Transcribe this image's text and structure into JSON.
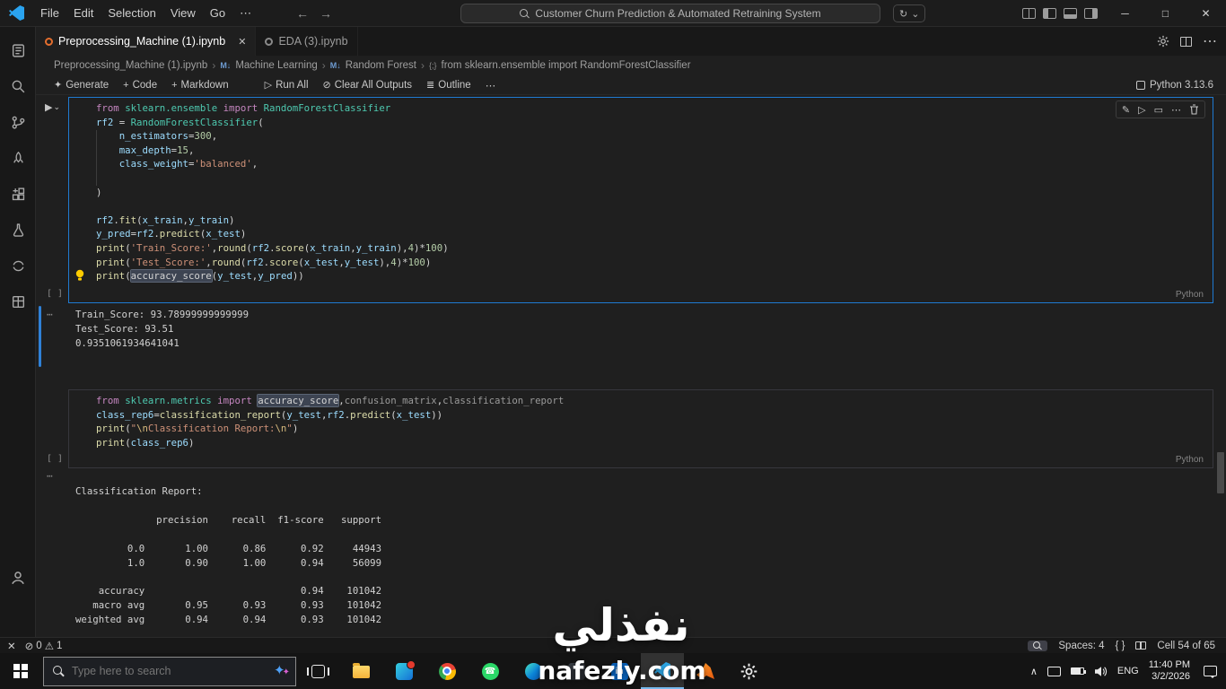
{
  "window": {
    "search_text": "Customer Churn Prediction & Automated Retraining System"
  },
  "menus": [
    "File",
    "Edit",
    "Selection",
    "View",
    "Go"
  ],
  "tabs": [
    {
      "label": "Preprocessing_Machine (1).ipynb"
    },
    {
      "label": "EDA (3).ipynb"
    }
  ],
  "breadcrumbs": [
    "Preprocessing_Machine (1).ipynb",
    "Machine Learning",
    "Random Forest",
    "from sklearn.ensemble import RandomForestClassifier"
  ],
  "toolbar": {
    "generate": "Generate",
    "code": "Code",
    "markdown": "Markdown",
    "run_all": "Run All",
    "clear_outputs": "Clear All Outputs",
    "outline": "Outline",
    "kernel": "Python 3.13.6"
  },
  "cells": [
    {
      "language": "Python",
      "lines": [
        [
          [
            "kw",
            "from"
          ],
          [
            "pun",
            " "
          ],
          [
            "cls",
            "sklearn.ensemble"
          ],
          [
            "pun",
            " "
          ],
          [
            "kw",
            "import"
          ],
          [
            "pun",
            " "
          ],
          [
            "cls",
            "RandomForestClassifier"
          ]
        ],
        [
          [
            "var",
            "rf2"
          ],
          [
            "pun",
            " = "
          ],
          [
            "cls",
            "RandomForestClassifier"
          ],
          [
            "pun",
            "("
          ]
        ],
        [
          [
            "pun",
            "    "
          ],
          [
            "var",
            "n_estimators"
          ],
          [
            "pun",
            "="
          ],
          [
            "num",
            "300"
          ],
          [
            "pun",
            ","
          ]
        ],
        [
          [
            "pun",
            "    "
          ],
          [
            "var",
            "max_depth"
          ],
          [
            "pun",
            "="
          ],
          [
            "num",
            "15"
          ],
          [
            "pun",
            ","
          ]
        ],
        [
          [
            "pun",
            "    "
          ],
          [
            "var",
            "class_weight"
          ],
          [
            "pun",
            "="
          ],
          [
            "str",
            "'balanced'"
          ],
          [
            "pun",
            ","
          ]
        ],
        [],
        [
          [
            "pun",
            ")"
          ]
        ],
        [],
        [
          [
            "var",
            "rf2"
          ],
          [
            "pun",
            "."
          ],
          [
            "fn",
            "fit"
          ],
          [
            "pun",
            "("
          ],
          [
            "var",
            "x_train"
          ],
          [
            "pun",
            ","
          ],
          [
            "var",
            "y_train"
          ],
          [
            "pun",
            ")"
          ]
        ],
        [
          [
            "var",
            "y_pred"
          ],
          [
            "pun",
            "="
          ],
          [
            "var",
            "rf2"
          ],
          [
            "pun",
            "."
          ],
          [
            "fn",
            "predict"
          ],
          [
            "pun",
            "("
          ],
          [
            "var",
            "x_test"
          ],
          [
            "pun",
            ")"
          ]
        ],
        [
          [
            "fn",
            "print"
          ],
          [
            "pun",
            "("
          ],
          [
            "str",
            "'Train_Score:'"
          ],
          [
            "pun",
            ","
          ],
          [
            "fn",
            "round"
          ],
          [
            "pun",
            "("
          ],
          [
            "var",
            "rf2"
          ],
          [
            "pun",
            "."
          ],
          [
            "fn",
            "score"
          ],
          [
            "pun",
            "("
          ],
          [
            "var",
            "x_train"
          ],
          [
            "pun",
            ","
          ],
          [
            "var",
            "y_train"
          ],
          [
            "pun",
            "),"
          ],
          [
            "num",
            "4"
          ],
          [
            "pun",
            ")*"
          ],
          [
            "num",
            "100"
          ],
          [
            "pun",
            ")"
          ]
        ],
        [
          [
            "fn",
            "print"
          ],
          [
            "pun",
            "("
          ],
          [
            "str",
            "'Test_Score:'"
          ],
          [
            "pun",
            ","
          ],
          [
            "fn",
            "round"
          ],
          [
            "pun",
            "("
          ],
          [
            "var",
            "rf2"
          ],
          [
            "pun",
            "."
          ],
          [
            "fn",
            "score"
          ],
          [
            "pun",
            "("
          ],
          [
            "var",
            "x_test"
          ],
          [
            "pun",
            ","
          ],
          [
            "var",
            "y_test"
          ],
          [
            "pun",
            "),"
          ],
          [
            "num",
            "4"
          ],
          [
            "pun",
            ")*"
          ],
          [
            "num",
            "100"
          ],
          [
            "pun",
            ")"
          ]
        ],
        [
          [
            "fn",
            "print"
          ],
          [
            "pun",
            "("
          ],
          [
            "hl",
            "accuracy_score"
          ],
          [
            "pun",
            "("
          ],
          [
            "var",
            "y_test"
          ],
          [
            "pun",
            ","
          ],
          [
            "var",
            "y_pred"
          ],
          [
            "pun",
            "))"
          ]
        ]
      ]
    },
    {
      "language": "Python",
      "lines": [
        [
          [
            "kw",
            "from"
          ],
          [
            "pun",
            " "
          ],
          [
            "cls",
            "sklearn.metrics"
          ],
          [
            "pun",
            " "
          ],
          [
            "kw",
            "import"
          ],
          [
            "pun",
            " "
          ],
          [
            "hl",
            "accuracy_score"
          ],
          [
            "pun",
            ","
          ],
          [
            "dim",
            "confusion_matrix"
          ],
          [
            "pun",
            ","
          ],
          [
            "dim",
            "classification_report"
          ]
        ],
        [
          [
            "var",
            "class_rep6"
          ],
          [
            "pun",
            "="
          ],
          [
            "fn",
            "classification_report"
          ],
          [
            "pun",
            "("
          ],
          [
            "var",
            "y_test"
          ],
          [
            "pun",
            ","
          ],
          [
            "var",
            "rf2"
          ],
          [
            "pun",
            "."
          ],
          [
            "fn",
            "predict"
          ],
          [
            "pun",
            "("
          ],
          [
            "var",
            "x_test"
          ],
          [
            "pun",
            "))"
          ]
        ],
        [
          [
            "fn",
            "print"
          ],
          [
            "pun",
            "("
          ],
          [
            "str",
            "\""
          ],
          [
            "esc",
            "\\n"
          ],
          [
            "str",
            "Classification Report:"
          ],
          [
            "esc",
            "\\n"
          ],
          [
            "str",
            "\""
          ],
          [
            "pun",
            ")"
          ]
        ],
        [
          [
            "fn",
            "print"
          ],
          [
            "pun",
            "("
          ],
          [
            "var",
            "class_rep6"
          ],
          [
            "pun",
            ")"
          ]
        ]
      ]
    }
  ],
  "outputs": [
    {
      "lines": [
        "Train_Score: 93.78999999999999",
        "Test_Score: 93.51",
        "0.9351061934641041"
      ]
    },
    {
      "lines": [
        "Classification Report:",
        "",
        "              precision    recall  f1-score   support",
        "",
        "         0.0       1.00      0.86      0.92     44943",
        "         1.0       0.90      1.00      0.94     56099",
        "",
        "    accuracy                           0.94    101042",
        "   macro avg       0.95      0.93      0.93    101042",
        "weighted avg       0.94      0.94      0.93    101042"
      ]
    }
  ],
  "statusbar": {
    "errors": "0",
    "warnings": "1",
    "spaces": "Spaces: 4",
    "cell": "Cell 54 of 65"
  },
  "taskbar": {
    "search_placeholder": "Type here to search"
  },
  "tray": {
    "lang": "ENG",
    "time": "11:40 PM",
    "date": "3/2/2026"
  },
  "watermark": {
    "arabic": "نفذلي",
    "domain": "nafezly.com"
  },
  "colors": {
    "accent": "#1f7ad1",
    "focus_bar": "#2f81d7",
    "warning": "#cccccc"
  },
  "icons": {
    "ellipsis": "⋯",
    "back": "←",
    "forward": "→",
    "minimize": "─",
    "maximize": "□",
    "close": "✕",
    "chevron_down": "⌄",
    "chevron_right": "›",
    "markdown_cell": "M↓",
    "code_cell": "{;}",
    "plus": "+",
    "sparkle": "✦",
    "run": "▶",
    "run_outline": "▷",
    "clear": "⊘",
    "outline": "≣",
    "exec_empty": "[ ]",
    "out_gutter": "⋯",
    "pencil": "✎",
    "frame": "▭",
    "error": "⊘",
    "warning": "⚠",
    "braces": "{ }",
    "tray_chevron": "∧",
    "phone": "☎",
    "refresh": "↻",
    "linkedin": "in"
  }
}
